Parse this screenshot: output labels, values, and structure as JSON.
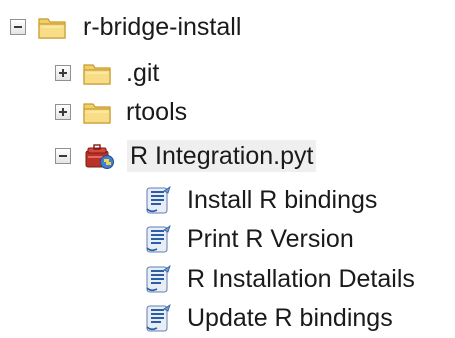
{
  "tree": {
    "root": {
      "label": "r-bridge-install",
      "expanded": true,
      "icon": "folder-icon"
    },
    "children": [
      {
        "label": ".git",
        "expanded": false,
        "icon": "folder-icon"
      },
      {
        "label": "rtools",
        "expanded": false,
        "icon": "folder-icon"
      },
      {
        "label": "R Integration.pyt",
        "expanded": true,
        "icon": "python-toolbox-icon"
      }
    ],
    "tools": [
      {
        "label": "Install R bindings",
        "icon": "script-tool-icon"
      },
      {
        "label": "Print R Version",
        "icon": "script-tool-icon"
      },
      {
        "label": "R Installation Details",
        "icon": "script-tool-icon"
      },
      {
        "label": "Update R bindings",
        "icon": "script-tool-icon"
      }
    ]
  },
  "colors": {
    "folder_body": "#f1d06a",
    "folder_border": "#c89a2c",
    "toolbox_red": "#c0392b",
    "script_blue": "#2a5fa8",
    "toggle_border": "#919191"
  }
}
